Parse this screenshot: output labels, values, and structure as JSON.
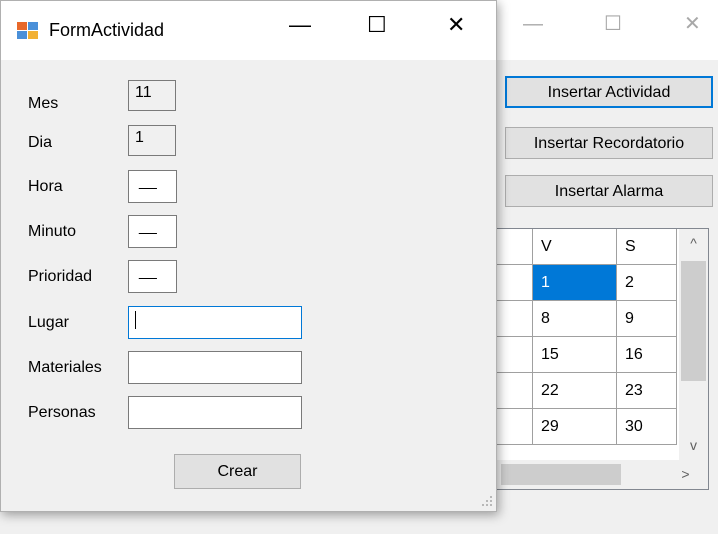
{
  "background_window": {
    "caption": {
      "minimize": "—",
      "maximize": "☐",
      "close": "✕"
    },
    "buttons": [
      "Insertar Actividad",
      "Insertar Recordatorio",
      "Insertar Alarma"
    ],
    "grid": {
      "headers": [
        "",
        "V",
        "S"
      ],
      "rows": [
        [
          "",
          "1",
          "2"
        ],
        [
          "",
          "8",
          "9"
        ],
        [
          "",
          "15",
          "16"
        ],
        [
          "",
          "22",
          "23"
        ],
        [
          "",
          "29",
          "30"
        ]
      ],
      "selected": "1",
      "scroll_up": "^",
      "scroll_down": "v",
      "scroll_right": ">"
    }
  },
  "dialog": {
    "title": "FormActividad",
    "caption": {
      "minimize": "—",
      "maximize": "☐",
      "close": "✕"
    },
    "fields": {
      "mes": {
        "label": "Mes",
        "value": "11"
      },
      "dia": {
        "label": "Dia",
        "value": "1"
      },
      "hora": {
        "label": "Hora",
        "value": "__"
      },
      "minuto": {
        "label": "Minuto",
        "value": "__"
      },
      "prioridad": {
        "label": "Prioridad",
        "value": "__"
      },
      "lugar": {
        "label": "Lugar",
        "value": ""
      },
      "materiales": {
        "label": "Materiales",
        "value": ""
      },
      "personas": {
        "label": "Personas",
        "value": ""
      }
    },
    "submit_label": "Crear"
  },
  "colors": {
    "accent": "#0078d7",
    "window_bg": "#f0f0f0",
    "button_bg": "#e1e1e1"
  },
  "icons": {
    "app": "windows-form-icon",
    "resize": "size-grip-icon"
  }
}
